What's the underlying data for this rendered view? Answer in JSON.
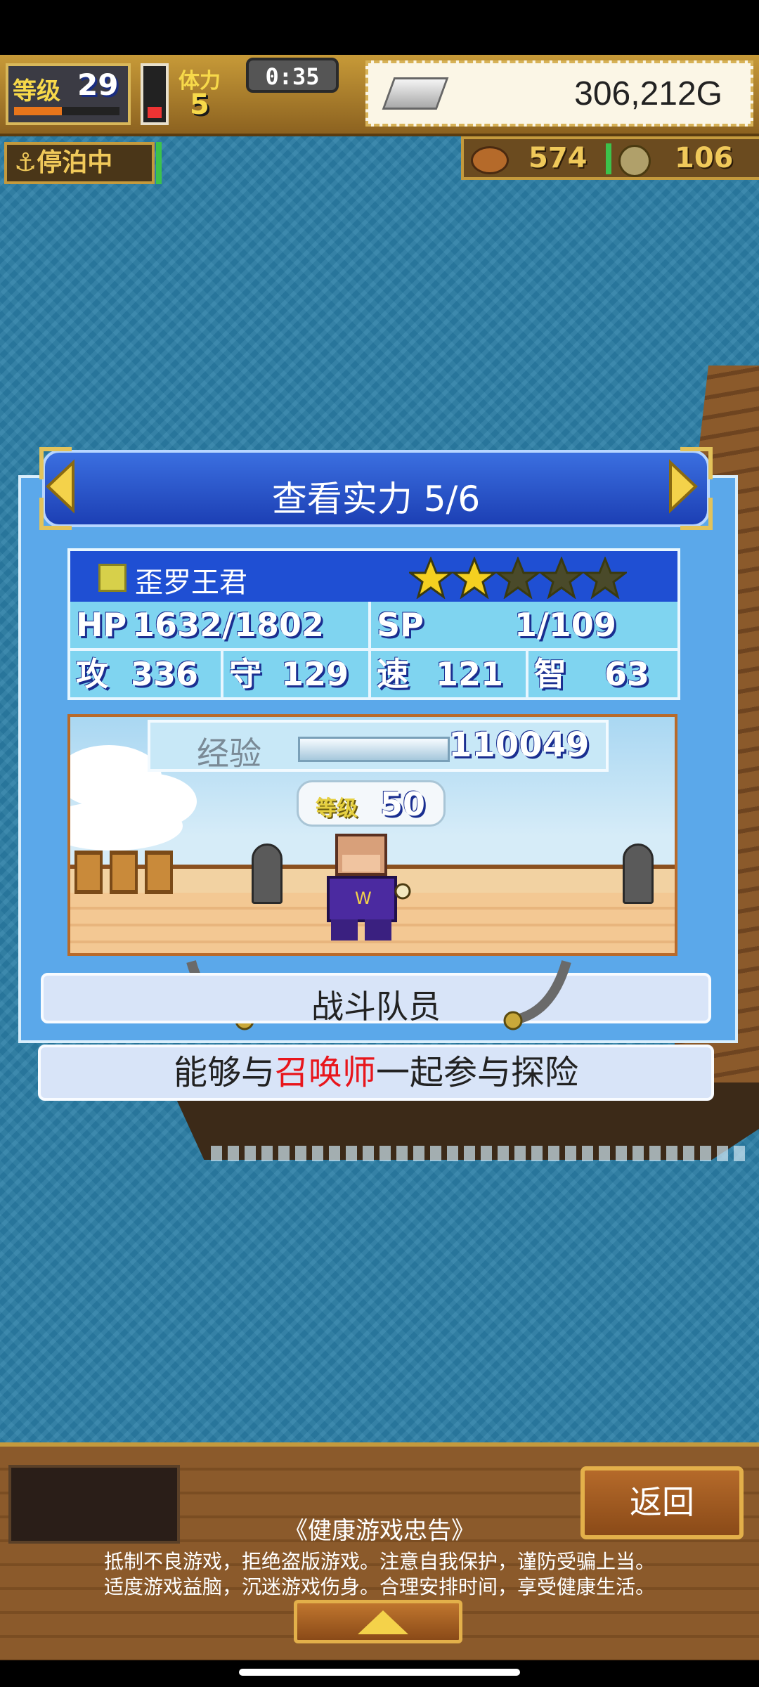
{
  "hud": {
    "level_label": "等级",
    "level": "29",
    "level_progress": 0.45,
    "stamina_label": "体力",
    "stamina": "5",
    "timer": "0:35",
    "gold": "306,212G",
    "dock_status": "停泊中",
    "resource_1": "574",
    "resource_2": "106"
  },
  "panel": {
    "title": "查看实力 5/6",
    "name": "歪罗王君",
    "stars_filled": 2,
    "stars_total": 5,
    "hp_label": "HP",
    "hp": "1632/1802",
    "sp_label": "SP",
    "sp": "1/109",
    "atk_label": "攻",
    "atk": "336",
    "def_label": "守",
    "def": "129",
    "spd_label": "速",
    "spd": "121",
    "int_label": "智",
    "int": "63",
    "exp_label": "经验",
    "exp": "110049",
    "level_tag": "等级",
    "level": "50",
    "role": "战斗队员",
    "desc_1": "能够与",
    "desc_2": "召唤师",
    "desc_3": "一起参与探险"
  },
  "bottom": {
    "back_label": "返回",
    "notice_title": "《健康游戏忠告》",
    "notice_line1": "抵制不良游戏，拒绝盗版游戏。注意自我保护，谨防受骗上当。",
    "notice_line2": "适度游戏益脑，沉迷游戏伤身。合理安排时间，享受健康生活。"
  },
  "colors": {
    "sea": "#2b7ea6",
    "panel": "#5ba8ea",
    "title_bar": "#1c3fb4",
    "highlight_text": "#e8161c",
    "star_gold": "#f4d020"
  }
}
